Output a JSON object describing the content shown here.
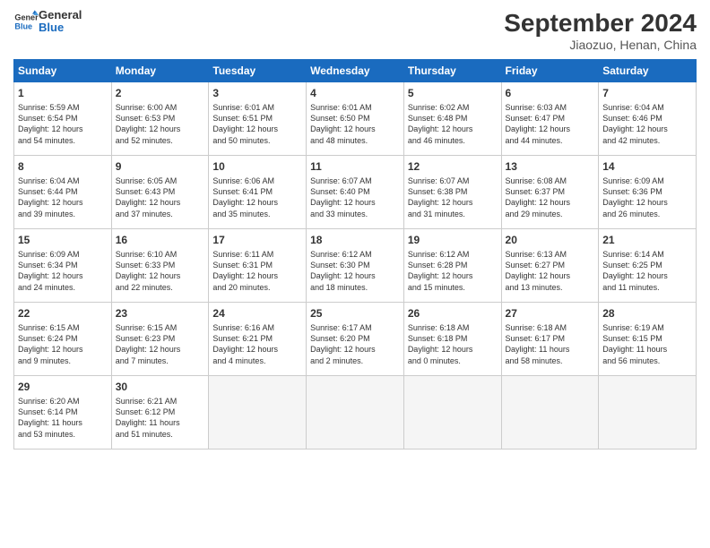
{
  "header": {
    "logo_line1": "General",
    "logo_line2": "Blue",
    "month_title": "September 2024",
    "location": "Jiaozuo, Henan, China"
  },
  "days_of_week": [
    "Sunday",
    "Monday",
    "Tuesday",
    "Wednesday",
    "Thursday",
    "Friday",
    "Saturday"
  ],
  "weeks": [
    [
      {
        "day": "1",
        "info": "Sunrise: 5:59 AM\nSunset: 6:54 PM\nDaylight: 12 hours\nand 54 minutes."
      },
      {
        "day": "2",
        "info": "Sunrise: 6:00 AM\nSunset: 6:53 PM\nDaylight: 12 hours\nand 52 minutes."
      },
      {
        "day": "3",
        "info": "Sunrise: 6:01 AM\nSunset: 6:51 PM\nDaylight: 12 hours\nand 50 minutes."
      },
      {
        "day": "4",
        "info": "Sunrise: 6:01 AM\nSunset: 6:50 PM\nDaylight: 12 hours\nand 48 minutes."
      },
      {
        "day": "5",
        "info": "Sunrise: 6:02 AM\nSunset: 6:48 PM\nDaylight: 12 hours\nand 46 minutes."
      },
      {
        "day": "6",
        "info": "Sunrise: 6:03 AM\nSunset: 6:47 PM\nDaylight: 12 hours\nand 44 minutes."
      },
      {
        "day": "7",
        "info": "Sunrise: 6:04 AM\nSunset: 6:46 PM\nDaylight: 12 hours\nand 42 minutes."
      }
    ],
    [
      {
        "day": "8",
        "info": "Sunrise: 6:04 AM\nSunset: 6:44 PM\nDaylight: 12 hours\nand 39 minutes."
      },
      {
        "day": "9",
        "info": "Sunrise: 6:05 AM\nSunset: 6:43 PM\nDaylight: 12 hours\nand 37 minutes."
      },
      {
        "day": "10",
        "info": "Sunrise: 6:06 AM\nSunset: 6:41 PM\nDaylight: 12 hours\nand 35 minutes."
      },
      {
        "day": "11",
        "info": "Sunrise: 6:07 AM\nSunset: 6:40 PM\nDaylight: 12 hours\nand 33 minutes."
      },
      {
        "day": "12",
        "info": "Sunrise: 6:07 AM\nSunset: 6:38 PM\nDaylight: 12 hours\nand 31 minutes."
      },
      {
        "day": "13",
        "info": "Sunrise: 6:08 AM\nSunset: 6:37 PM\nDaylight: 12 hours\nand 29 minutes."
      },
      {
        "day": "14",
        "info": "Sunrise: 6:09 AM\nSunset: 6:36 PM\nDaylight: 12 hours\nand 26 minutes."
      }
    ],
    [
      {
        "day": "15",
        "info": "Sunrise: 6:09 AM\nSunset: 6:34 PM\nDaylight: 12 hours\nand 24 minutes."
      },
      {
        "day": "16",
        "info": "Sunrise: 6:10 AM\nSunset: 6:33 PM\nDaylight: 12 hours\nand 22 minutes."
      },
      {
        "day": "17",
        "info": "Sunrise: 6:11 AM\nSunset: 6:31 PM\nDaylight: 12 hours\nand 20 minutes."
      },
      {
        "day": "18",
        "info": "Sunrise: 6:12 AM\nSunset: 6:30 PM\nDaylight: 12 hours\nand 18 minutes."
      },
      {
        "day": "19",
        "info": "Sunrise: 6:12 AM\nSunset: 6:28 PM\nDaylight: 12 hours\nand 15 minutes."
      },
      {
        "day": "20",
        "info": "Sunrise: 6:13 AM\nSunset: 6:27 PM\nDaylight: 12 hours\nand 13 minutes."
      },
      {
        "day": "21",
        "info": "Sunrise: 6:14 AM\nSunset: 6:25 PM\nDaylight: 12 hours\nand 11 minutes."
      }
    ],
    [
      {
        "day": "22",
        "info": "Sunrise: 6:15 AM\nSunset: 6:24 PM\nDaylight: 12 hours\nand 9 minutes."
      },
      {
        "day": "23",
        "info": "Sunrise: 6:15 AM\nSunset: 6:23 PM\nDaylight: 12 hours\nand 7 minutes."
      },
      {
        "day": "24",
        "info": "Sunrise: 6:16 AM\nSunset: 6:21 PM\nDaylight: 12 hours\nand 4 minutes."
      },
      {
        "day": "25",
        "info": "Sunrise: 6:17 AM\nSunset: 6:20 PM\nDaylight: 12 hours\nand 2 minutes."
      },
      {
        "day": "26",
        "info": "Sunrise: 6:18 AM\nSunset: 6:18 PM\nDaylight: 12 hours\nand 0 minutes."
      },
      {
        "day": "27",
        "info": "Sunrise: 6:18 AM\nSunset: 6:17 PM\nDaylight: 11 hours\nand 58 minutes."
      },
      {
        "day": "28",
        "info": "Sunrise: 6:19 AM\nSunset: 6:15 PM\nDaylight: 11 hours\nand 56 minutes."
      }
    ],
    [
      {
        "day": "29",
        "info": "Sunrise: 6:20 AM\nSunset: 6:14 PM\nDaylight: 11 hours\nand 53 minutes."
      },
      {
        "day": "30",
        "info": "Sunrise: 6:21 AM\nSunset: 6:12 PM\nDaylight: 11 hours\nand 51 minutes."
      },
      {
        "day": "",
        "info": ""
      },
      {
        "day": "",
        "info": ""
      },
      {
        "day": "",
        "info": ""
      },
      {
        "day": "",
        "info": ""
      },
      {
        "day": "",
        "info": ""
      }
    ]
  ]
}
